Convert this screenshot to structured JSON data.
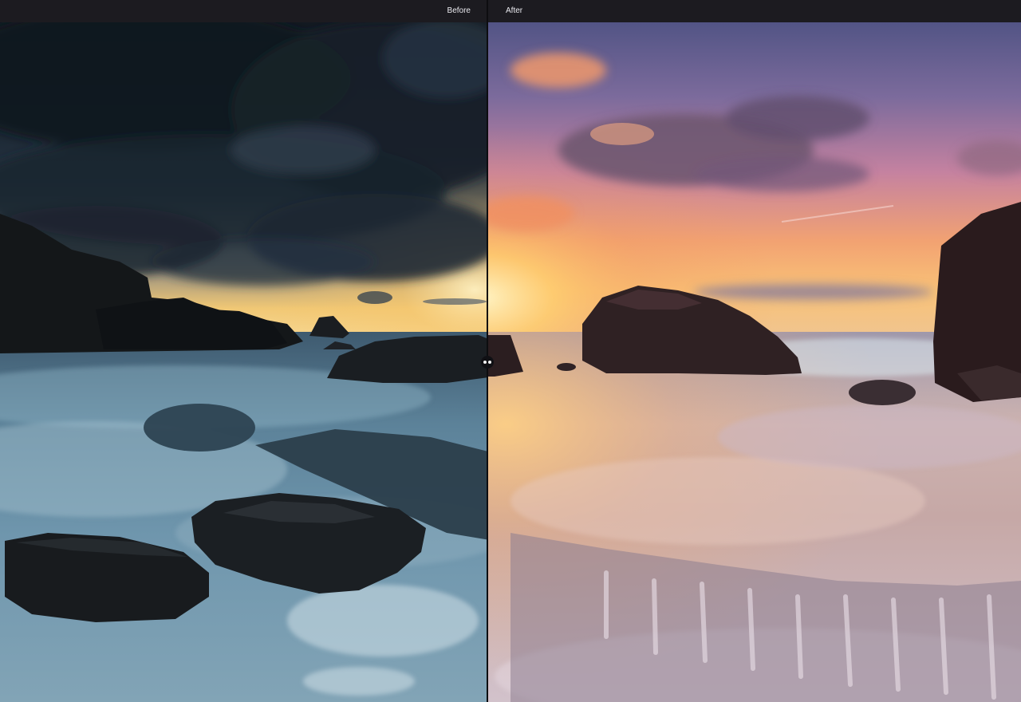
{
  "comparison": {
    "before_label": "Before",
    "after_label": "After"
  },
  "image": {
    "subject": "seascape-sunset-rocks",
    "before_palette": {
      "sky_dark": "#151c24",
      "sky_mid": "#29394a",
      "horizon": "#f4c777",
      "water": "#6d94ab",
      "rocks": "#15181c"
    },
    "after_palette": {
      "sky_top": "#5d5a90",
      "sky_mid": "#c485a2",
      "horizon": "#f4b25a",
      "water": "#c4aeb8",
      "rocks": "#2d2022"
    }
  },
  "icons": {
    "handle": "split-handle-icon"
  }
}
